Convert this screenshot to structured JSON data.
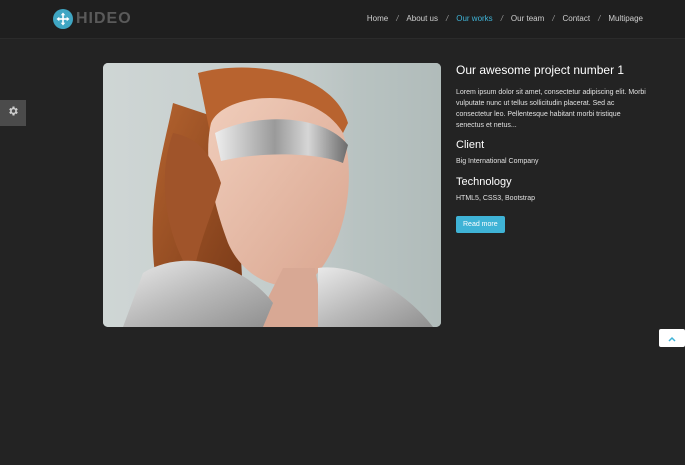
{
  "brand": {
    "name": "HIDEO",
    "accent": "#3fb3d6"
  },
  "nav": {
    "items": [
      {
        "label": "Home"
      },
      {
        "label": "About us"
      },
      {
        "label": "Our works",
        "active": true
      },
      {
        "label": "Our team"
      },
      {
        "label": "Contact"
      },
      {
        "label": "Multipage"
      }
    ],
    "separator": "/"
  },
  "project": {
    "title": "Our awesome project number 1",
    "description": "Lorem ipsum dolor sit amet, consectetur adipiscing elit. Morbi vulputate nunc ut tellus sollicitudin placerat. Sed ac consectetur leo. Pellentesque habitant morbi tristique senectus et netus...",
    "client_heading": "Client",
    "client_value": "Big International Company",
    "tech_heading": "Technology",
    "tech_value": "HTML5, CSS3, Bootstrap",
    "read_more_label": "Read more"
  },
  "icons": {
    "logo": "move-arrows-icon",
    "settings": "gear-icon",
    "back_to_top": "chevron-up-icon"
  }
}
